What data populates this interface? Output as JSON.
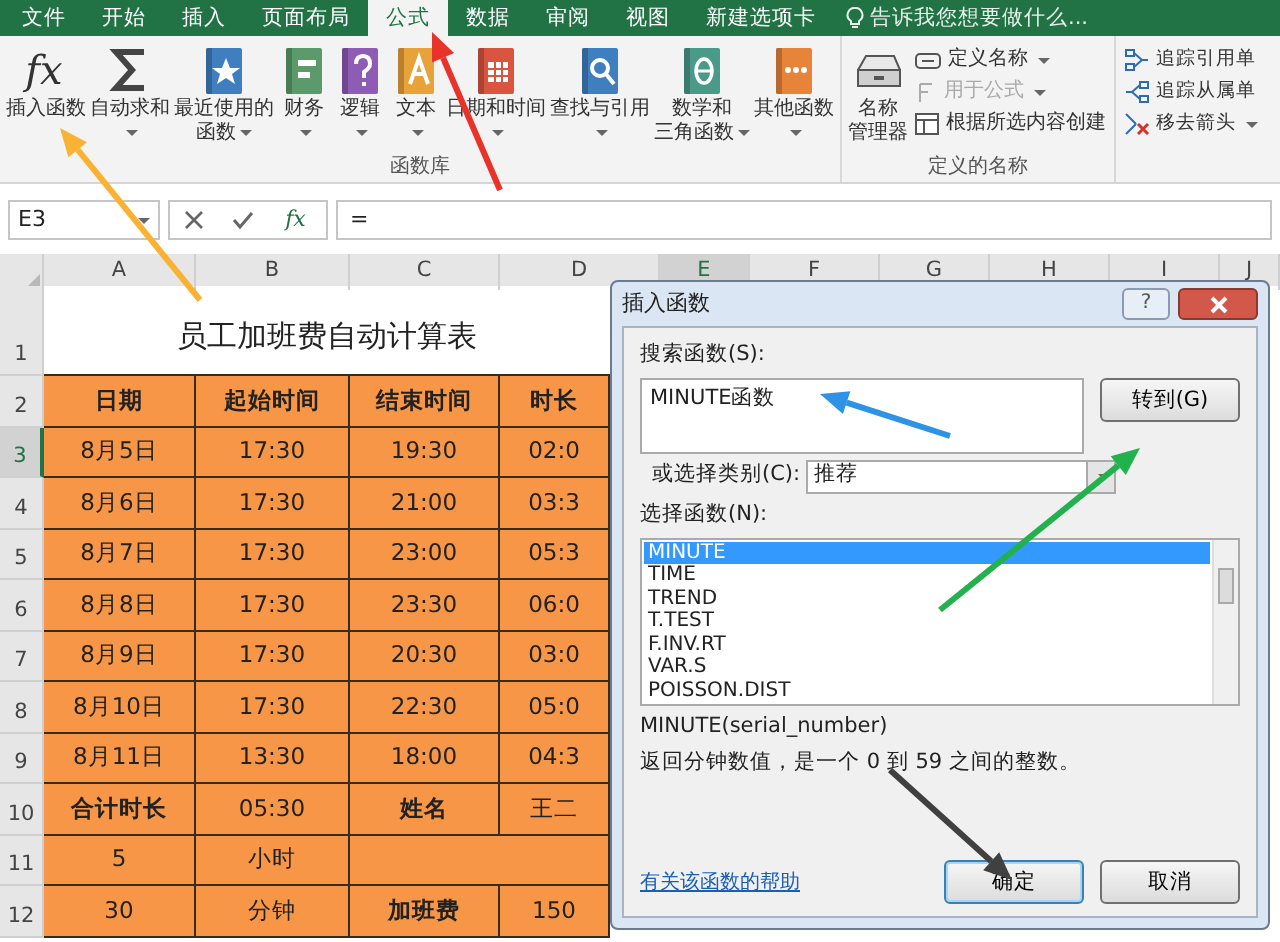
{
  "ribbon_tabs": [
    {
      "label": "文件",
      "selected": false
    },
    {
      "label": "开始",
      "selected": false
    },
    {
      "label": "插入",
      "selected": false
    },
    {
      "label": "页面布局",
      "selected": false
    },
    {
      "label": "公式",
      "selected": true
    },
    {
      "label": "数据",
      "selected": false
    },
    {
      "label": "审阅",
      "selected": false
    },
    {
      "label": "视图",
      "selected": false
    },
    {
      "label": "新建选项卡",
      "selected": false
    }
  ],
  "tell_me": "告诉我您想要做什么...",
  "function_library": {
    "label": "函数库",
    "buttons": [
      {
        "kind": "insert",
        "glyph": "fx",
        "lines": [
          "插入函数"
        ],
        "dropdown": false
      },
      {
        "kind": "sum",
        "lines": [
          "自动求和"
        ],
        "dropdown": true
      },
      {
        "kind": "recent",
        "lines": [
          "最近使用的",
          "函数"
        ],
        "dropdown": true
      },
      {
        "kind": "finance",
        "lines": [
          "财务"
        ],
        "dropdown": true
      },
      {
        "kind": "logic",
        "lines": [
          "逻辑"
        ],
        "dropdown": true
      },
      {
        "kind": "text",
        "lines": [
          "文本"
        ],
        "dropdown": true
      },
      {
        "kind": "date",
        "lines": [
          "日期和时间"
        ],
        "dropdown": true
      },
      {
        "kind": "lookup",
        "lines": [
          "查找与引用"
        ],
        "dropdown": true
      },
      {
        "kind": "math",
        "lines": [
          "数学和",
          "三角函数"
        ],
        "dropdown": true
      },
      {
        "kind": "other",
        "lines": [
          "其他函数"
        ],
        "dropdown": true
      }
    ]
  },
  "defined_names": {
    "label": "定义的名称",
    "manager": {
      "lines": [
        "名称",
        "管理器"
      ]
    },
    "items": [
      {
        "kind": "define",
        "label": "定义名称",
        "dropdown": true,
        "disabled": false
      },
      {
        "kind": "use",
        "label": "用于公式",
        "dropdown": true,
        "disabled": true
      },
      {
        "kind": "create",
        "label": "根据所选内容创建",
        "dropdown": false,
        "disabled": false
      }
    ]
  },
  "auditing": {
    "items": [
      {
        "kind": "precedents",
        "label": "追踪引用单"
      },
      {
        "kind": "dependents",
        "label": "追踪从属单"
      },
      {
        "kind": "remove",
        "label": "移去箭头",
        "dropdown": true
      }
    ]
  },
  "formula_bar": {
    "name_box": "E3",
    "fx": "fx",
    "formula": "="
  },
  "sheet": {
    "columns": [
      {
        "label": "A",
        "selected": false
      },
      {
        "label": "B",
        "selected": false
      },
      {
        "label": "C",
        "selected": false
      },
      {
        "label": "D",
        "selected": false
      },
      {
        "label": "E",
        "selected": true
      },
      {
        "label": "F",
        "selected": false
      },
      {
        "label": "G",
        "selected": false
      },
      {
        "label": "H",
        "selected": false
      },
      {
        "label": "I",
        "selected": false
      },
      {
        "label": "J",
        "selected": false
      }
    ],
    "title_row": {
      "number": "1",
      "text": "员工加班费自动计算表"
    },
    "rows": [
      {
        "number": "2",
        "selected": false,
        "cells": [
          {
            "text": "日期",
            "bold": true
          },
          {
            "text": "起始时间",
            "bold": true
          },
          {
            "text": "结束时间",
            "bold": true
          },
          {
            "text": "时长",
            "bold": true
          }
        ]
      },
      {
        "number": "3",
        "selected": true,
        "cells": [
          {
            "text": "8月5日"
          },
          {
            "text": "17:30"
          },
          {
            "text": "19:30"
          },
          {
            "text": "02:0"
          }
        ]
      },
      {
        "number": "4",
        "selected": false,
        "cells": [
          {
            "text": "8月6日"
          },
          {
            "text": "17:30"
          },
          {
            "text": "21:00"
          },
          {
            "text": "03:3"
          }
        ]
      },
      {
        "number": "5",
        "selected": false,
        "cells": [
          {
            "text": "8月7日"
          },
          {
            "text": "17:30"
          },
          {
            "text": "23:00"
          },
          {
            "text": "05:3"
          }
        ]
      },
      {
        "number": "6",
        "selected": false,
        "cells": [
          {
            "text": "8月8日"
          },
          {
            "text": "17:30"
          },
          {
            "text": "23:30"
          },
          {
            "text": "06:0"
          }
        ]
      },
      {
        "number": "7",
        "selected": false,
        "cells": [
          {
            "text": "8月9日"
          },
          {
            "text": "17:30"
          },
          {
            "text": "20:30"
          },
          {
            "text": "03:0"
          }
        ]
      },
      {
        "number": "8",
        "selected": false,
        "cells": [
          {
            "text": "8月10日"
          },
          {
            "text": "17:30"
          },
          {
            "text": "22:30"
          },
          {
            "text": "05:0"
          }
        ]
      },
      {
        "number": "9",
        "selected": false,
        "cells": [
          {
            "text": "8月11日"
          },
          {
            "text": "13:30"
          },
          {
            "text": "18:00"
          },
          {
            "text": "04:3"
          }
        ]
      },
      {
        "number": "10",
        "selected": false,
        "cells": [
          {
            "text": "合计时长",
            "bold": true
          },
          {
            "text": "05:30"
          },
          {
            "text": "姓名",
            "bold": true
          },
          {
            "text": "王二"
          }
        ]
      },
      {
        "number": "11",
        "selected": false,
        "cells": [
          {
            "text": "5"
          },
          {
            "text": "小时"
          },
          {
            "kind": "blank"
          }
        ]
      },
      {
        "number": "12",
        "selected": false,
        "cells": [
          {
            "text": "30"
          },
          {
            "text": "分钟"
          },
          {
            "text": "加班费",
            "bold": true
          },
          {
            "text": "150"
          }
        ]
      }
    ]
  },
  "dialog": {
    "title": "插入函数",
    "help": "?",
    "search_label": "搜索函数(S):",
    "search_value": "MINUTE函数",
    "go_button": "转到(G)",
    "category_label": "或选择类别(C):",
    "category_value": "推荐",
    "list_label": "选择函数(N):",
    "functions": [
      {
        "name": "MINUTE",
        "selected": true
      },
      {
        "name": "TIME",
        "selected": false
      },
      {
        "name": "TREND",
        "selected": false
      },
      {
        "name": "T.TEST",
        "selected": false
      },
      {
        "name": "F.INV.RT",
        "selected": false
      },
      {
        "name": "VAR.S",
        "selected": false
      },
      {
        "name": "POISSON.DIST",
        "selected": false
      }
    ],
    "signature": "MINUTE(serial_number)",
    "description": "返回分钟数值，是一个 0 到 59 之间的整数。",
    "help_link": "有关该函数的帮助",
    "ok_button": "确定",
    "cancel_button": "取消"
  },
  "arrows": [
    {
      "color": "#f9b233"
    },
    {
      "color": "#e8322a"
    },
    {
      "color": "#2e93e6"
    },
    {
      "color": "#22b14c"
    },
    {
      "color": "#404040"
    }
  ]
}
